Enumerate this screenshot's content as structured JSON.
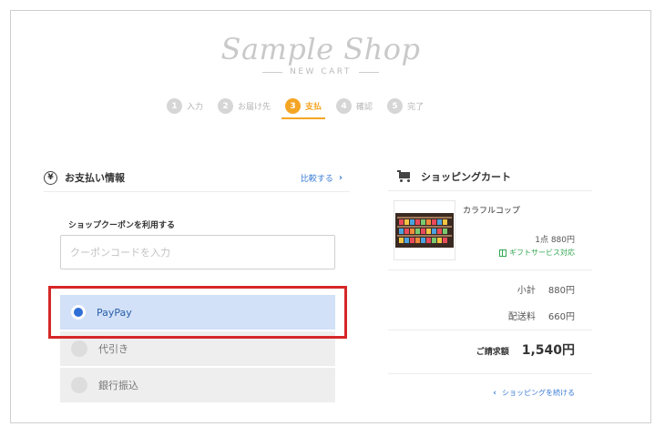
{
  "logo": {
    "name": "Sample Shop",
    "subtitle": "NEW CART"
  },
  "steps": [
    {
      "num": "1",
      "label": "入力"
    },
    {
      "num": "2",
      "label": "お届け先"
    },
    {
      "num": "3",
      "label": "支払"
    },
    {
      "num": "4",
      "label": "確認"
    },
    {
      "num": "5",
      "label": "完了"
    }
  ],
  "payment": {
    "title": "お支払い情報",
    "compare_label": "比較する",
    "coupon_label": "ショップクーポンを利用する",
    "coupon_placeholder": "クーポンコードを入力",
    "options": [
      {
        "label": "PayPay",
        "selected": true
      },
      {
        "label": "代引き",
        "selected": false
      },
      {
        "label": "銀行振込",
        "selected": false
      }
    ]
  },
  "cart": {
    "title": "ショッピングカート",
    "item": {
      "name": "カラフルコップ",
      "qty_price": "1点 880円",
      "gift_label": "ギフトサービス対応"
    },
    "subtotal_label": "小計",
    "subtotal_value": "880円",
    "shipping_label": "配送料",
    "shipping_value": "660円",
    "total_label": "ご請求額",
    "total_value": "1,540円",
    "continue_label": "ショッピングを続ける"
  },
  "colors": {
    "accent": "#f5a524",
    "link": "#3a7bd5",
    "selected_bg": "#d2e1f8",
    "highlight": "#d62728",
    "gift_green": "#34a853"
  }
}
